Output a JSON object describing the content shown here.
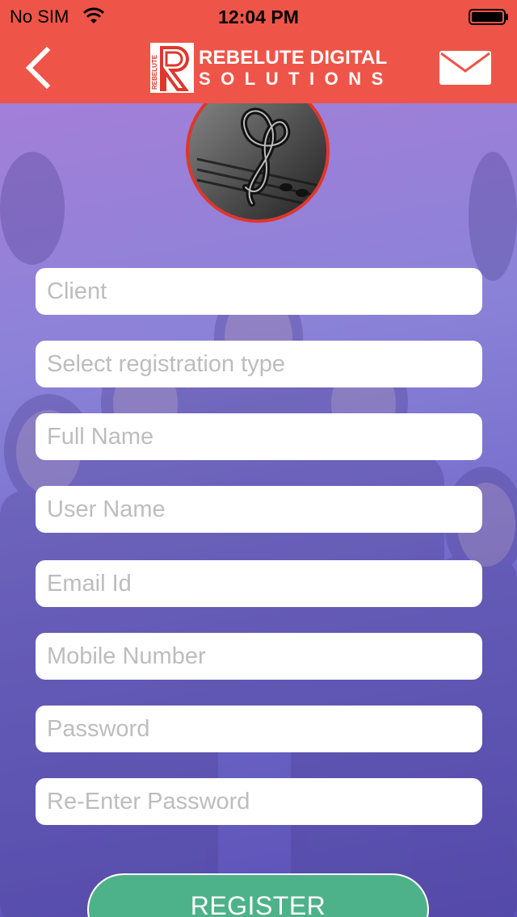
{
  "status_bar": {
    "carrier": "No SIM",
    "time": "12:04 PM",
    "wifi_icon": "wifi-icon",
    "battery_icon": "battery-icon"
  },
  "nav_bar": {
    "background_color": "#ee5548",
    "back_icon": "chevron-left-icon",
    "logo": {
      "mark_text": "REBELUTE",
      "line1": "REBELUTE DIGITAL",
      "line2": "SOLUTIONS"
    },
    "mail_icon": "envelope-icon"
  },
  "avatar": {
    "icon": "music-clef-icon",
    "border_color": "#e0362c"
  },
  "form": {
    "fields": [
      {
        "placeholder": "Client",
        "value": ""
      },
      {
        "placeholder": "Select registration type",
        "value": ""
      },
      {
        "placeholder": "Full Name",
        "value": ""
      },
      {
        "placeholder": "User Name",
        "value": ""
      },
      {
        "placeholder": "Email Id",
        "value": ""
      },
      {
        "placeholder": "Mobile Number",
        "value": ""
      },
      {
        "placeholder": "Password",
        "value": ""
      },
      {
        "placeholder": "Re-Enter Password",
        "value": ""
      }
    ],
    "submit_label": "REGISTER",
    "submit_color": "#4db28a"
  }
}
